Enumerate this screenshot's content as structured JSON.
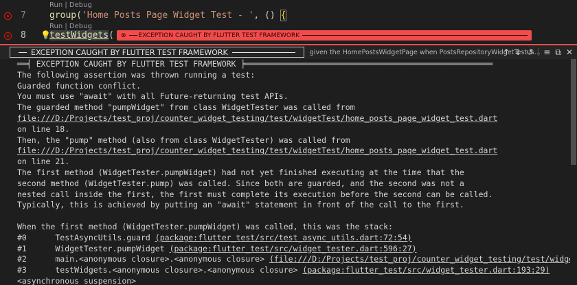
{
  "editor": {
    "codelens": [
      "Run | Debug",
      "Run | Debug"
    ],
    "lines": [
      {
        "number": "7",
        "func": "group",
        "open": "(",
        "string": "'Home Posts Page Widget Test - '",
        "rest": ", () ",
        "brace": "{"
      },
      {
        "number": "8",
        "func": "testWidgets",
        "open": "("
      }
    ],
    "inline_error": "EXCEPTION CAUGHT BY FLUTTER TEST FRAMEWORK"
  },
  "peek": {
    "tab_label": "EXCEPTION CAUGHT BY FLUTTER TEST FRAMEWORK",
    "description": "given the HomePostsWidgetPage when PostsRepositoryWidgetTest is...",
    "actions": [
      "arrow-up-icon",
      "arrow-down-icon",
      "history-icon",
      "collapse-icon",
      "open-icon",
      "close-icon"
    ]
  },
  "output": {
    "lines": [
      {
        "text": "══╡ EXCEPTION CAUGHT BY FLUTTER TEST FRAMEWORK ╞════════════════════════════════════════════════════"
      },
      {
        "text": "The following assertion was thrown running a test:"
      },
      {
        "text": "Guarded function conflict."
      },
      {
        "text": "You must use \"await\" with all Future-returning test APIs."
      },
      {
        "text": "The guarded method \"pumpWidget\" from class WidgetTester was called from"
      },
      {
        "link": "file:///D:/Projects/test_proj/counter_widget_testing/test/widgetTest/home_posts_page_widget_test.dart"
      },
      {
        "text": "on line 18."
      },
      {
        "text": "Then, the \"pump\" method (also from class WidgetTester) was called from"
      },
      {
        "link": "file:///D:/Projects/test_proj/counter_widget_testing/test/widgetTest/home_posts_page_widget_test.dart"
      },
      {
        "text": "on line 21."
      },
      {
        "text": "The first method (WidgetTester.pumpWidget) had not yet finished executing at the time that the"
      },
      {
        "text": "second method (WidgetTester.pump) was called. Since both are guarded, and the second was not a"
      },
      {
        "text": "nested call inside the first, the first must complete its execution before the second can be called."
      },
      {
        "text": "Typically, this is achieved by putting an \"await\" statement in front of the call to the first."
      },
      {
        "text": ""
      },
      {
        "text": "When the first method (WidgetTester.pumpWidget) was called, this was the stack:"
      },
      {
        "text": "#0      TestAsyncUtils.guard ",
        "link": "(package:flutter_test/src/test_async_utils.dart:72:54)"
      },
      {
        "text": "#1      WidgetTester.pumpWidget ",
        "link": "(package:flutter_test/src/widget_tester.dart:596:27)"
      },
      {
        "text": "#2      main.<anonymous closure>.<anonymous closure> ",
        "link": "(file:///D:/Projects/test_proj/counter_widget_testing/test/widgetTest/hom"
      },
      {
        "text": "#3      testWidgets.<anonymous closure>.<anonymous closure> ",
        "link": "(package:flutter_test/src/widget_tester.dart:193:29)"
      },
      {
        "text": "<asynchronous suspension>"
      }
    ]
  }
}
